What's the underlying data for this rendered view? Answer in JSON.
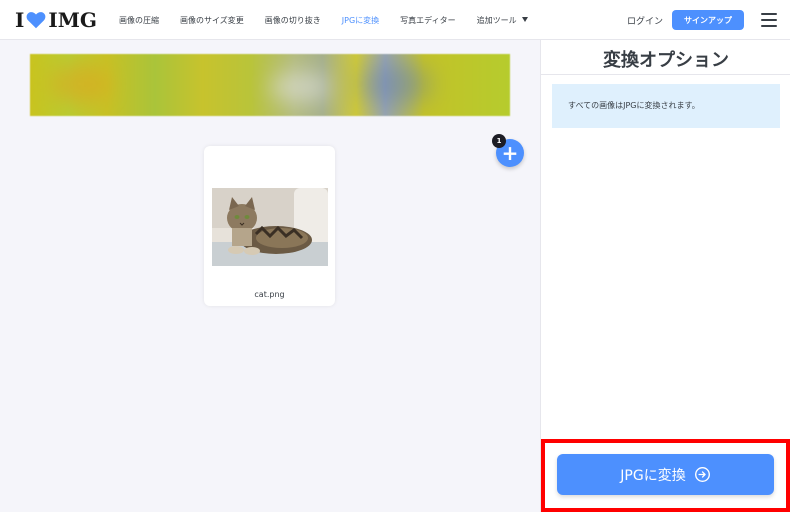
{
  "header": {
    "logo_text_left": "I",
    "logo_text_right": "IMG",
    "nav": [
      {
        "label": "画像の圧縮"
      },
      {
        "label": "画像のサイズ変更"
      },
      {
        "label": "画像の切り抜き"
      },
      {
        "label": "JPGに変換",
        "active": true
      },
      {
        "label": "写真エディター"
      },
      {
        "label": "追加ツール"
      }
    ],
    "login_label": "ログイン",
    "signup_label": "サインアップ"
  },
  "workspace": {
    "file_count": "1",
    "add_icon": "plus-icon",
    "files": [
      {
        "name": "cat.png"
      }
    ]
  },
  "sidebar": {
    "title": "変換オプション",
    "info_text": "すべての画像はJPGに変換されます。",
    "convert_label": "JPGに変換"
  },
  "colors": {
    "accent": "#4d90fe",
    "info_bg": "#dff0fd",
    "highlight": "#ff0000",
    "logo_heart": "#4d90fe"
  }
}
